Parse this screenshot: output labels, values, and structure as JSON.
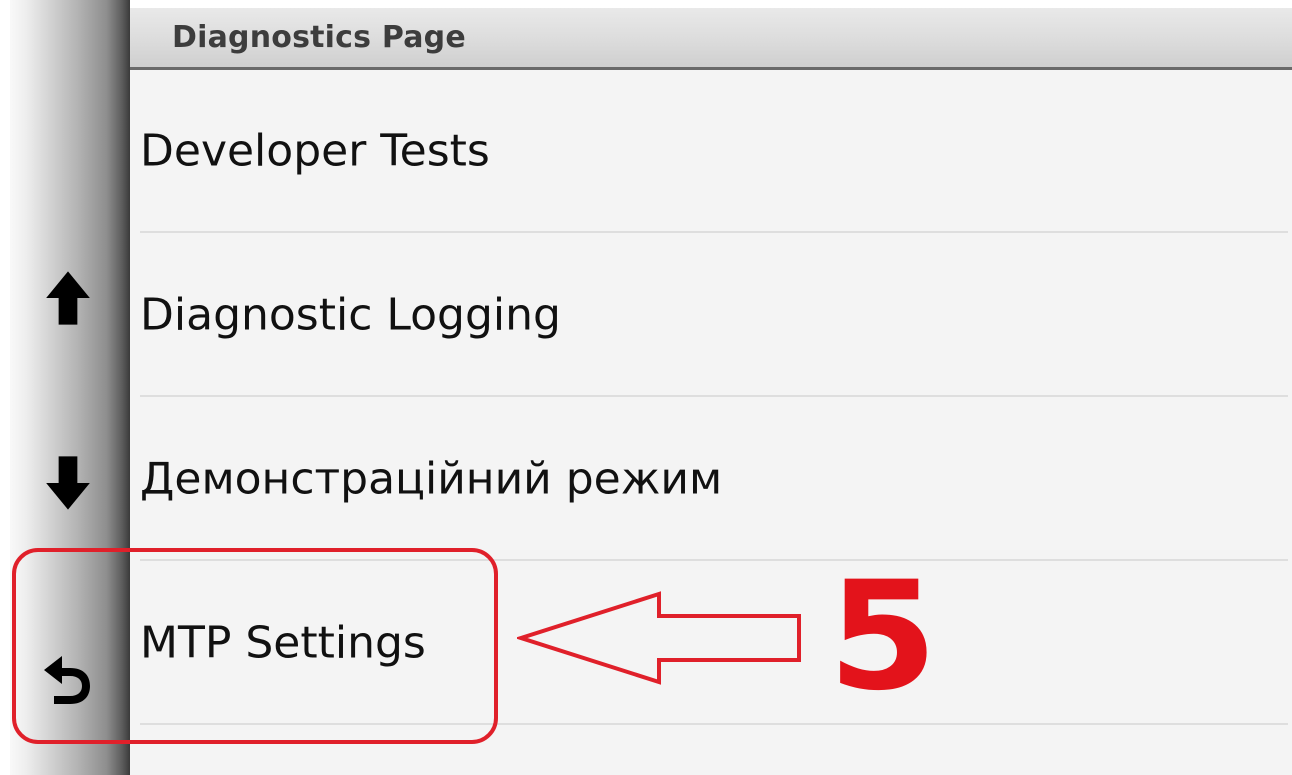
{
  "header": {
    "title": "Diagnostics Page"
  },
  "list": {
    "items": [
      {
        "label": "Developer Tests"
      },
      {
        "label": "Diagnostic Logging"
      },
      {
        "label": "Демонстраційний режим"
      },
      {
        "label": "MTP Settings"
      }
    ]
  },
  "sidebar": {
    "up_icon": "arrow-up-icon",
    "down_icon": "arrow-down-icon",
    "back_icon": "back-icon"
  },
  "annotation": {
    "step_number": "5",
    "color": "#e3131b"
  }
}
